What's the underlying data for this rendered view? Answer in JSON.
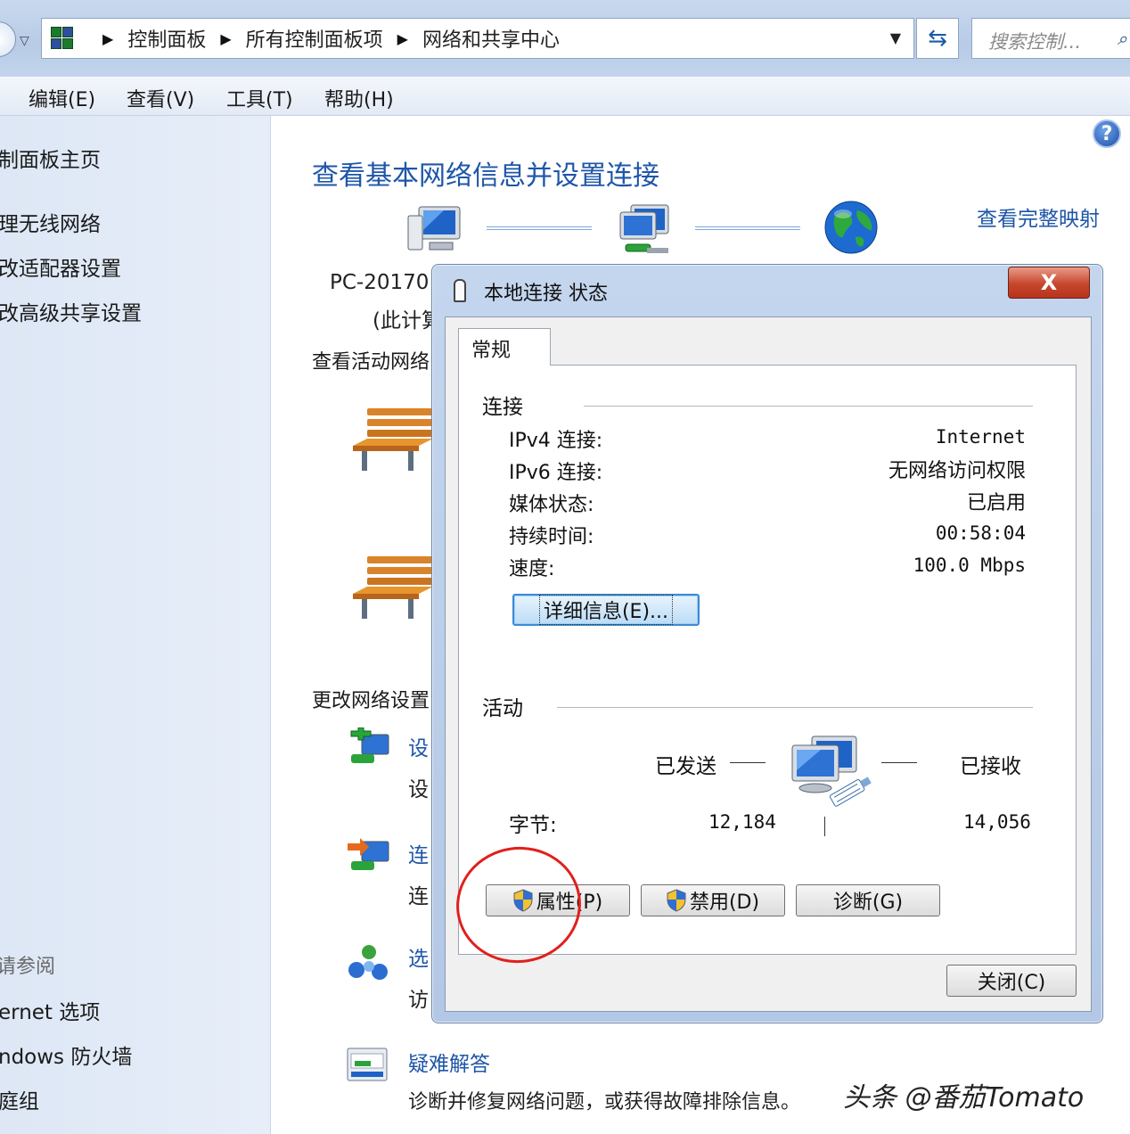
{
  "address_bar": {
    "crumbs": [
      "控制面板",
      "所有控制面板项",
      "网络和共享中心"
    ],
    "search_placeholder": "搜索控制..."
  },
  "menu": [
    "编辑(E)",
    "查看(V)",
    "工具(T)",
    "帮助(H)"
  ],
  "sidebar": {
    "links": [
      "制面板主页",
      "理无线网络",
      "改适配器设置",
      "改高级共享设置"
    ],
    "see_also_label": "请参阅",
    "see_also": [
      "ernet 选项",
      "ndows 防火墙",
      "庭组"
    ]
  },
  "main": {
    "title": "查看基本网络信息并设置连接",
    "full_map_link": "查看完整映射",
    "computer_name": "PC-20170",
    "computer_sub": "(此计算",
    "active_networks_heading": "查看活动网络",
    "change_settings_heading": "更改网络设置",
    "tasks": [
      {
        "link": "设",
        "desc": "设"
      },
      {
        "link": "连",
        "desc": "连"
      },
      {
        "link": "选",
        "desc": "访"
      }
    ],
    "troubleshoot_link": "疑难解答",
    "troubleshoot_desc": "诊断并修复网络问题，或获得故障排除信息。"
  },
  "dialog": {
    "title": "本地连接 状态",
    "close_glyph": "X",
    "tab": "常规",
    "connection_group": "连接",
    "rows": [
      {
        "label": "IPv4 连接:",
        "value": "Internet"
      },
      {
        "label": "IPv6 连接:",
        "value": "无网络访问权限"
      },
      {
        "label": "媒体状态:",
        "value": "已启用"
      },
      {
        "label": "持续时间:",
        "value": "00:58:04"
      },
      {
        "label": "速度:",
        "value": "100.0 Mbps"
      }
    ],
    "details_button": "详细信息(E)...",
    "activity_group": "活动",
    "sent_label": "已发送",
    "received_label": "已接收",
    "bytes_label": "字节:",
    "bytes_sent": "12,184",
    "bytes_received": "14,056",
    "properties_button": "属性(P)",
    "disable_button": "禁用(D)",
    "diagnose_button": "诊断(G)",
    "close_button": "关闭(C)"
  },
  "watermark": "头条 @番茄Tomato",
  "colors": {
    "link_blue": "#1e56a8",
    "annotation_red": "#e0201c",
    "window_frame": "#b7cbe6"
  },
  "icons": [
    "control-panel-icon",
    "refresh-icon",
    "search-icon",
    "help-icon",
    "computer-icon",
    "network-icon",
    "globe-icon",
    "bench-icon",
    "shield-icon"
  ]
}
